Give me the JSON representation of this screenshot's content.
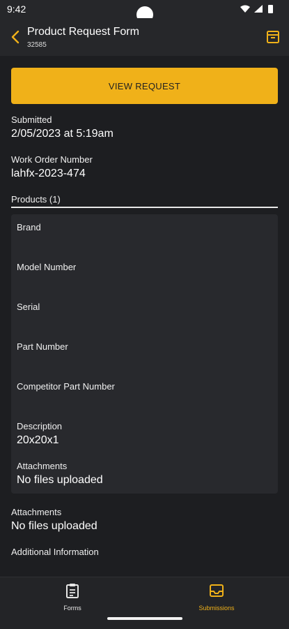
{
  "status": {
    "time": "9:42"
  },
  "header": {
    "title": "Product Request Form",
    "subtitle": "32585"
  },
  "actions": {
    "view_request": "VIEW REQUEST"
  },
  "fields": {
    "submitted_label": "Submitted",
    "submitted_value": "2/05/2023 at 5:19am",
    "work_order_label": "Work Order Number",
    "work_order_value": "lahfx-2023-474",
    "products_label": "Products (1)"
  },
  "product": {
    "brand_label": "Brand",
    "model_label": "Model Number",
    "serial_label": "Serial",
    "part_label": "Part Number",
    "competitor_label": "Competitor Part Number",
    "description_label": "Description",
    "description_value": "20x20x1",
    "attachments_label": "Attachments",
    "attachments_value": "No files uploaded"
  },
  "attachments": {
    "label": "Attachments",
    "value": "No files uploaded"
  },
  "additional": {
    "label": "Additional Information"
  },
  "nav": {
    "forms": "Forms",
    "submissions": "Submissions"
  },
  "colors": {
    "accent": "#f0b119",
    "background": "#1d1e21",
    "card": "#28292d"
  },
  "icons": [
    "back-arrow-icon",
    "archive-icon",
    "clipboard-icon",
    "inbox-icon",
    "wifi-icon",
    "signal-icon",
    "battery-icon"
  ]
}
